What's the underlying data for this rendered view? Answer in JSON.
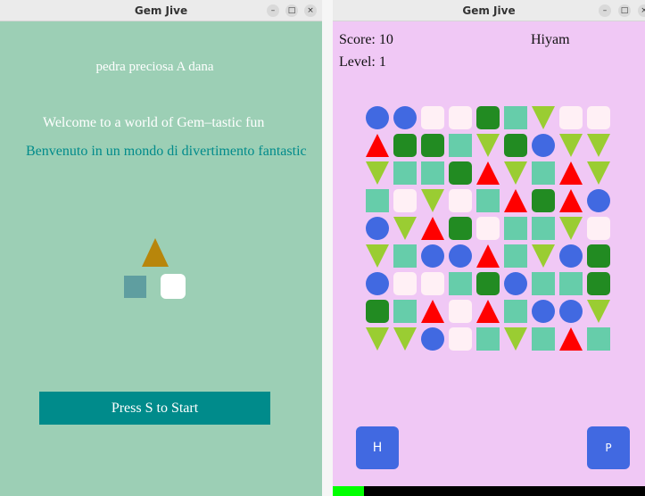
{
  "left_window": {
    "title": "Gem Jive",
    "subtitle": "pedra preciosa A dana",
    "welcome_en": "Welcome to a world of Gem–tastic fun",
    "welcome_it": "Benvenuto in un mondo di divertimento fantastic",
    "start_label": "Press S to Start"
  },
  "right_window": {
    "title": "Gem Jive",
    "score_text": "Score: 10",
    "player_name": "Hiyam",
    "level_text": "Level: 1",
    "h_button": "H",
    "p_button": "P",
    "progress": 0.1
  },
  "window_controls": {
    "minimize": "–",
    "maximize": "□",
    "close": "×"
  },
  "gem_colors": {
    "circle": "#4169e1",
    "pink-square": "#fff0f5",
    "green-square": "#228b22",
    "teal-square": "#66cdaa",
    "tri-down": "#9acd32",
    "tri-up": "#ff0000"
  },
  "board": [
    [
      "circle",
      "circle",
      "pink-square",
      "pink-square",
      "green-square",
      "teal-square",
      "tri-down",
      "pink-square",
      "pink-square"
    ],
    [
      "tri-up",
      "green-square",
      "green-square",
      "teal-square",
      "tri-down",
      "green-square",
      "circle",
      "tri-down",
      "tri-down"
    ],
    [
      "tri-down",
      "teal-square",
      "teal-square",
      "green-square",
      "tri-up",
      "tri-down",
      "teal-square",
      "tri-up",
      "tri-down"
    ],
    [
      "teal-square",
      "pink-square",
      "tri-down",
      "pink-square",
      "teal-square",
      "tri-up",
      "green-square",
      "tri-up",
      "circle"
    ],
    [
      "circle",
      "tri-down",
      "tri-up",
      "green-square",
      "pink-square",
      "teal-square",
      "teal-square",
      "tri-down",
      "pink-square"
    ],
    [
      "tri-down",
      "teal-square",
      "circle",
      "circle",
      "tri-up",
      "teal-square",
      "tri-down",
      "circle",
      "green-square"
    ],
    [
      "circle",
      "pink-square",
      "pink-square",
      "teal-square",
      "green-square",
      "circle",
      "teal-square",
      "teal-square",
      "green-square"
    ],
    [
      "green-square",
      "teal-square",
      "tri-up",
      "pink-square",
      "tri-up",
      "teal-square",
      "circle",
      "circle",
      "tri-down"
    ],
    [
      "tri-down",
      "tri-down",
      "circle",
      "pink-square",
      "teal-square",
      "tri-down",
      "teal-square",
      "tri-up",
      "teal-square"
    ]
  ]
}
